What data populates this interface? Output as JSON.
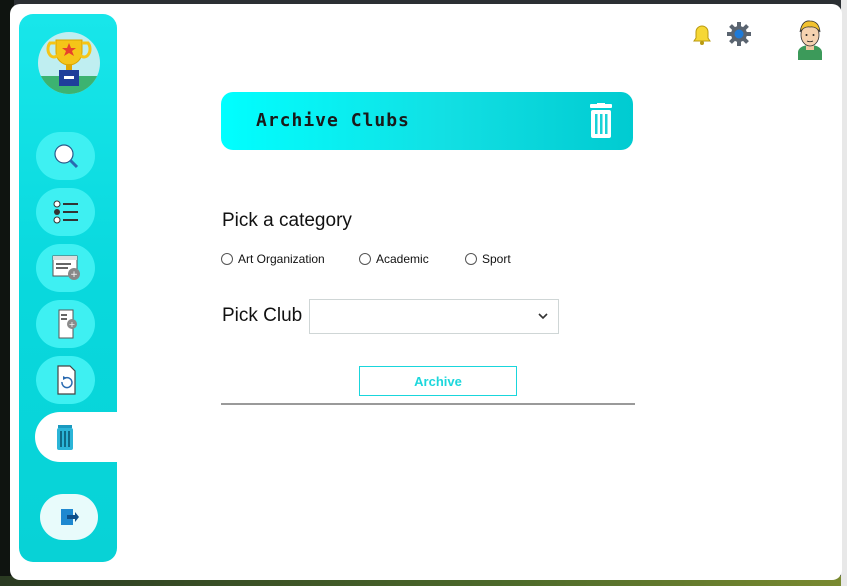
{
  "header": {
    "title": "Archive Clubs"
  },
  "form": {
    "category_label": "Pick a category",
    "categories": [
      "Art Organization",
      "Academic",
      "Sport"
    ],
    "club_label": "Pick Club",
    "club_selected": "",
    "archive_label": "Archive"
  },
  "sidebar": {
    "items": [
      {
        "icon": "search-icon"
      },
      {
        "icon": "list-icon"
      },
      {
        "icon": "add-form-icon"
      },
      {
        "icon": "add-document-icon"
      },
      {
        "icon": "refresh-document-icon"
      },
      {
        "icon": "trash-icon",
        "active": true
      }
    ],
    "logout_icon": "logout-icon"
  },
  "top_bar": {
    "icons": [
      "bell-icon",
      "gear-icon",
      "user-avatar"
    ]
  },
  "colors": {
    "accent": "#12dfe3",
    "accent_light": "#00ffff",
    "text": "#111111"
  }
}
